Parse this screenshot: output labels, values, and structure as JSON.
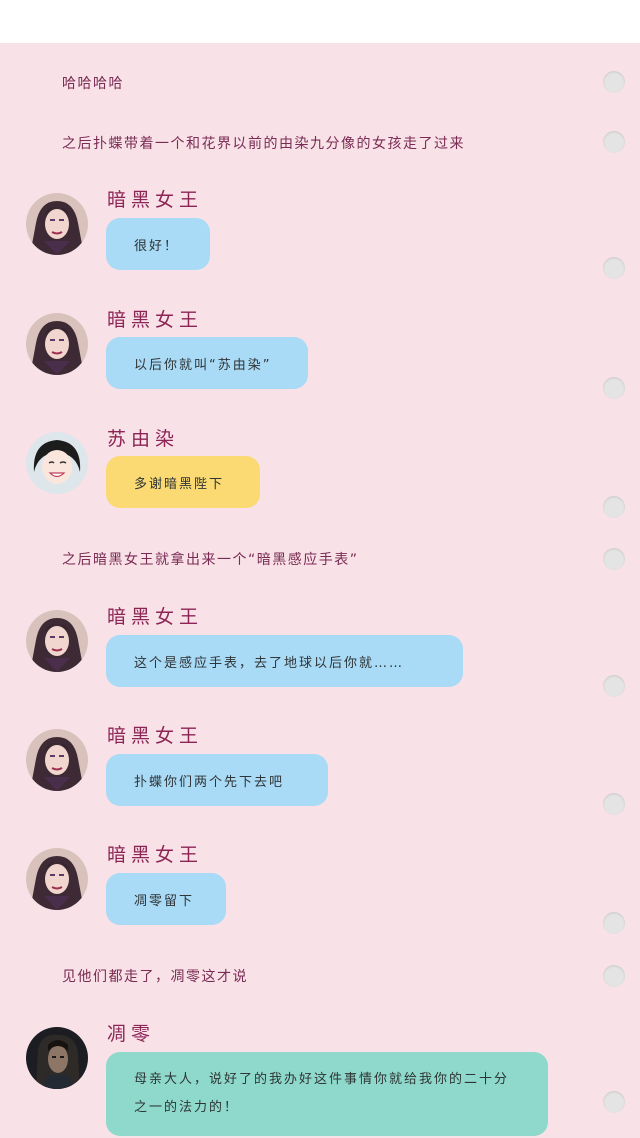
{
  "narration": [
    "哈哈哈哈",
    "之后扑蝶带着一个和花界以前的由染九分像的女孩走了过来",
    "之后暗黑女王就拿出来一个“暗黑感应手表”",
    "见他们都走了，凋零这才说"
  ],
  "messages": [
    {
      "sender": "暗黑女王",
      "text": "很好！"
    },
    {
      "sender": "暗黑女王",
      "text": "以后你就叫“苏由染”"
    },
    {
      "sender": "苏由染",
      "text": "多谢暗黑陛下"
    },
    {
      "sender": "暗黑女王",
      "text": "这个是感应手表，去了地球以后你就……"
    },
    {
      "sender": "暗黑女王",
      "text": "扑蝶你们两个先下去吧"
    },
    {
      "sender": "暗黑女王",
      "text": "凋零留下"
    },
    {
      "sender": "凋零",
      "text": "母亲大人，说好了的我办好这件事情你就给我你的二十分之一的法力的！"
    }
  ],
  "colors": {
    "background": "#f8e1e7",
    "name": "#8c2455",
    "bubble_queen": "#a9daf6",
    "bubble_suyouran": "#fbd973",
    "bubble_diaoling": "#8ed9cb"
  },
  "avatars": {
    "queen": "dark-queen-avatar",
    "suyouran": "su-you-ran-avatar",
    "diaoling": "diao-ling-avatar"
  }
}
